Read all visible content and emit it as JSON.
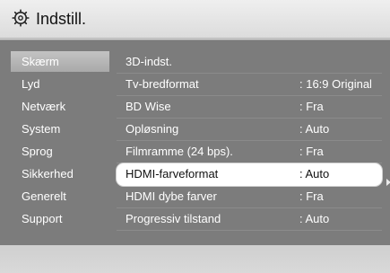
{
  "header": {
    "title": "Indstill.",
    "icon": "gear-icon"
  },
  "sidebar": {
    "items": [
      {
        "label": "Skærm",
        "active": true
      },
      {
        "label": "Lyd",
        "active": false
      },
      {
        "label": "Netværk",
        "active": false
      },
      {
        "label": "System",
        "active": false
      },
      {
        "label": "Sprog",
        "active": false
      },
      {
        "label": "Sikkerhed",
        "active": false
      },
      {
        "label": "Generelt",
        "active": false
      },
      {
        "label": "Support",
        "active": false
      }
    ]
  },
  "settings": {
    "rows": [
      {
        "label": "3D-indst.",
        "value": ""
      },
      {
        "label": "Tv-bredformat",
        "value": ": 16:9 Original"
      },
      {
        "label": "BD Wise",
        "value": ": Fra"
      },
      {
        "label": "Opløsning",
        "value": ": Auto"
      },
      {
        "label": "Filmramme (24 bps).",
        "value": ": Fra"
      },
      {
        "label": "HDMI-farveformat",
        "value": ": Auto",
        "selected": true
      },
      {
        "label": "HDMI dybe farver",
        "value": ": Fra"
      },
      {
        "label": "Progressiv tilstand",
        "value": ": Auto"
      }
    ]
  },
  "colors": {
    "panel": "#7c7c7c",
    "highlight": "#ffffff",
    "sidebar_active": "#b7b7b7"
  }
}
